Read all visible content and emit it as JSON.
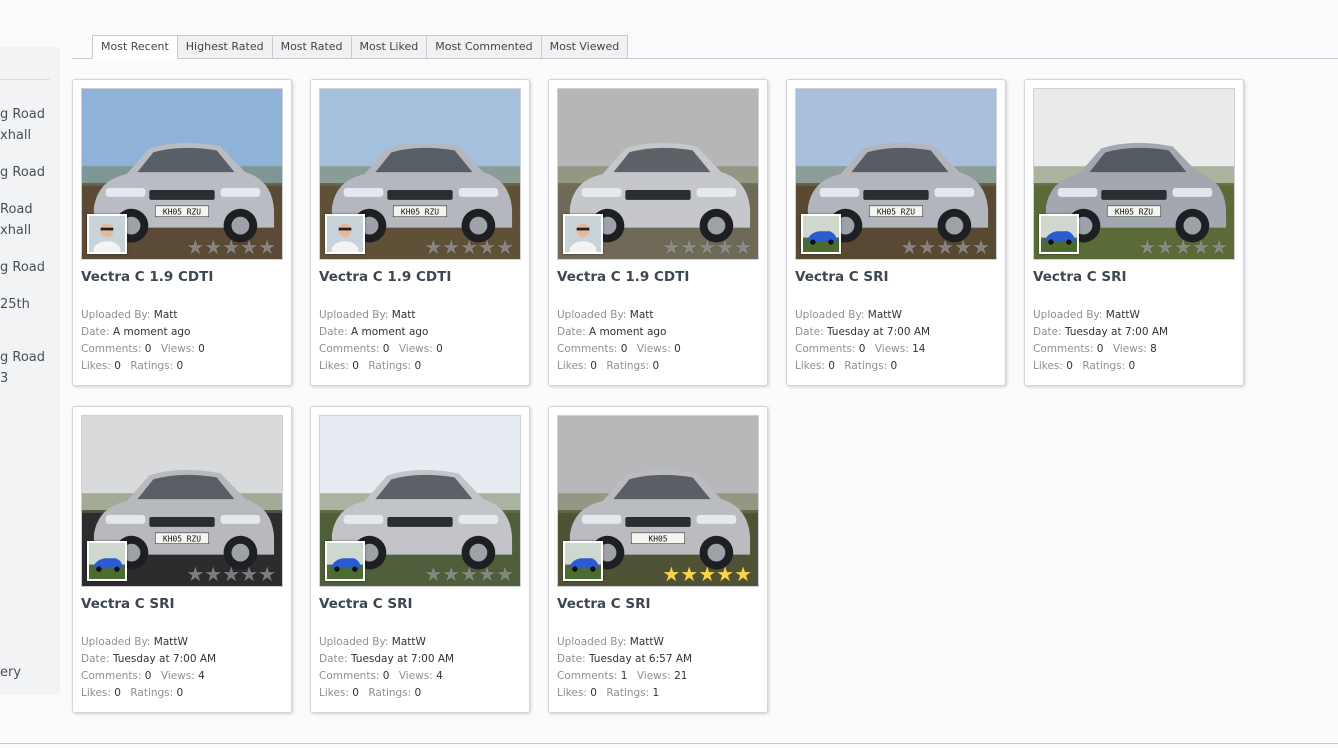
{
  "tabs": [
    {
      "label": "Most Recent",
      "active": true
    },
    {
      "label": "Highest Rated"
    },
    {
      "label": "Most Rated"
    },
    {
      "label": "Most Liked"
    },
    {
      "label": "Most Commented"
    },
    {
      "label": "Most Viewed"
    }
  ],
  "sidebar": {
    "fragments": [
      "g Road",
      "xhall",
      "g Road",
      "Road",
      "xhall",
      "g Road",
      "25th",
      "g Road",
      "3",
      "ery"
    ]
  },
  "labels": {
    "uploaded_by": "Uploaded By:",
    "date": "Date:",
    "comments": "Comments:",
    "views": "Views:",
    "likes": "Likes:",
    "ratings": "Ratings:"
  },
  "items": [
    {
      "title": "Vectra C 1.9 CDTI",
      "uploader": "Matt",
      "date": "A moment ago",
      "comments": "0",
      "views": "0",
      "likes": "0",
      "ratings": "0",
      "stars": 0,
      "plate": "KH05 RZU"
    },
    {
      "title": "Vectra C 1.9 CDTI",
      "uploader": "Matt",
      "date": "A moment ago",
      "comments": "0",
      "views": "0",
      "likes": "0",
      "ratings": "0",
      "stars": 0,
      "plate": "KH05 RZU"
    },
    {
      "title": "Vectra C 1.9 CDTI",
      "uploader": "Matt",
      "date": "A moment ago",
      "comments": "0",
      "views": "0",
      "likes": "0",
      "ratings": "0",
      "stars": 0,
      "plate": ""
    },
    {
      "title": "Vectra C SRI",
      "uploader": "MattW",
      "date": "Tuesday at 7:00 AM",
      "comments": "0",
      "views": "14",
      "likes": "0",
      "ratings": "0",
      "stars": 0,
      "plate": "KH05 RZU"
    },
    {
      "title": "Vectra C SRI",
      "uploader": "MattW",
      "date": "Tuesday at 7:00 AM",
      "comments": "0",
      "views": "8",
      "likes": "0",
      "ratings": "0",
      "stars": 0,
      "plate": "KH05 RZU"
    },
    {
      "title": "Vectra C SRI",
      "uploader": "MattW",
      "date": "Tuesday at 7:00 AM",
      "comments": "0",
      "views": "4",
      "likes": "0",
      "ratings": "0",
      "stars": 0,
      "plate": "KH05 RZU"
    },
    {
      "title": "Vectra C SRI",
      "uploader": "MattW",
      "date": "Tuesday at 7:00 AM",
      "comments": "0",
      "views": "4",
      "likes": "0",
      "ratings": "0",
      "stars": 0,
      "plate": ""
    },
    {
      "title": "Vectra C SRI",
      "uploader": "MattW",
      "date": "Tuesday at 6:57 AM",
      "comments": "1",
      "views": "21",
      "likes": "0",
      "ratings": "1",
      "stars": 5,
      "plate": "KH05"
    }
  ],
  "colors": {
    "star_on": "#f7d44a",
    "card_border": "#d3d5d9",
    "title": "#3e4751"
  },
  "icons": {
    "rating": "star-icon"
  }
}
